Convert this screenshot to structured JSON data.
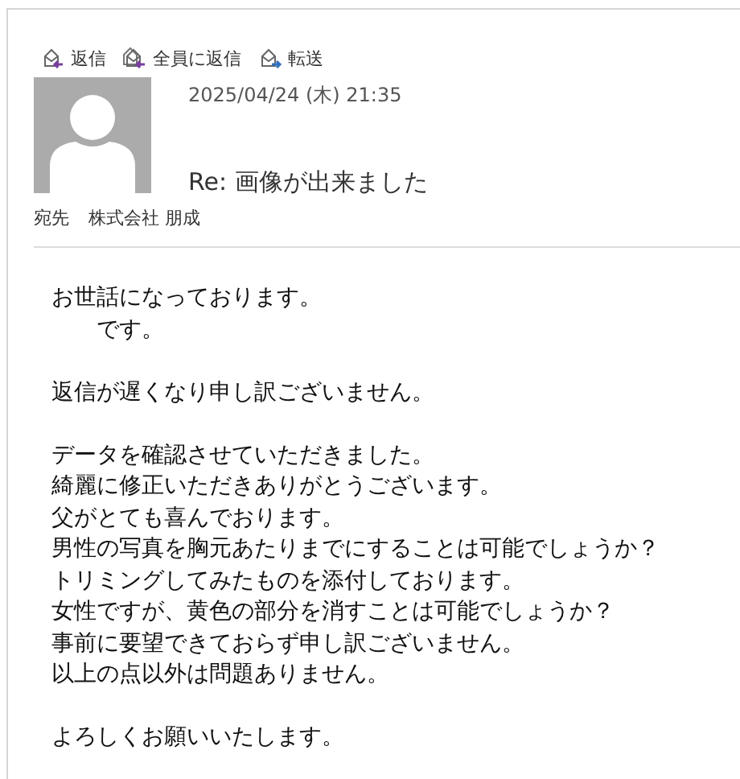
{
  "toolbar": [
    {
      "kind": "reply",
      "label": "返信"
    },
    {
      "kind": "reply_all",
      "label": "全員に返信"
    },
    {
      "kind": "forward",
      "label": "転送"
    }
  ],
  "message": {
    "date": "2025/04/24 (木) 21:35",
    "subject": "Re: 画像が出来ました",
    "to_label": "宛先",
    "to": "株式会社 朋成"
  },
  "body": [
    [
      "お世話になっております。",
      "　　です。"
    ],
    [
      "返信が遅くなり申し訳ございません。"
    ],
    [
      "データを確認させていただきました。",
      "綺麗に修正いただきありがとうございます。",
      "父がとても喜んでおります。",
      "男性の写真を胸元あたりまでにすることは可能でしょうか？",
      "トリミングしてみたものを添付しております。",
      "女性ですが、黄色の部分を消すことは可能でしょうか？",
      "事前に要望できておらず申し訳ございません。",
      "以上の点以外は問題ありません。"
    ],
    [
      "よろしくお願いいたします。"
    ]
  ]
}
